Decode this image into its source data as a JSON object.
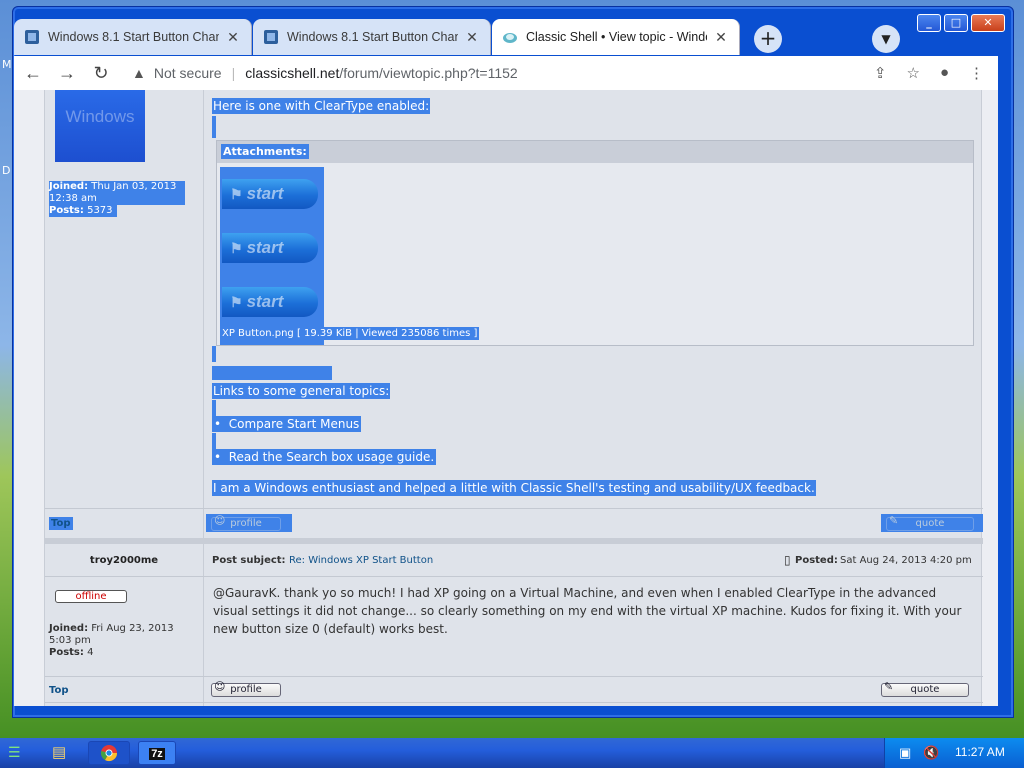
{
  "desktop": {
    "letters": [
      "M",
      "D"
    ]
  },
  "browser": {
    "tabs": [
      {
        "title": "Windows 8.1 Start Button Change",
        "close": "✕"
      },
      {
        "title": "Windows 8.1 Start Button Change",
        "close": "✕"
      },
      {
        "title": "Classic Shell • View topic - Windows",
        "close": "✕"
      }
    ],
    "new_tab": "+",
    "window_buttons": {
      "minimize": "_",
      "maximize": "□",
      "close": "✕"
    },
    "address": {
      "security": "Not secure",
      "host": "classicshell.net",
      "path": "/forum/viewtopic.php?t=1152"
    }
  },
  "post1": {
    "avatar_text": "Windows",
    "joined_label": "Joined:",
    "joined_value": "Thu Jan 03, 2013 12:38 am",
    "posts_label": "Posts:",
    "posts_value": "5373",
    "line_cleartype": "Here is one with ClearType enabled:",
    "attachments_header": "Attachments:",
    "start_label": "start",
    "attachment_caption": "XP Button.png [ 19.39 KiB | Viewed 235086 times ]",
    "links_heading": "Links to some general topics:",
    "link1": "Compare Start Menus",
    "link2": "Read the Search box usage guide.",
    "signature": "I am a Windows enthusiast and helped a little with Classic Shell's testing and usability/UX feedback.",
    "top_link": "Top",
    "profile_btn": "profile",
    "quote_btn": "quote"
  },
  "post2": {
    "author": "troy2000me",
    "subject_label": "Post subject:",
    "subject_value": "Re: Windows XP Start Button",
    "posted_label": "Posted:",
    "posted_value": "Sat Aug 24, 2013 4:20 pm",
    "status": "offline",
    "joined_label": "Joined:",
    "joined_value": "Fri Aug 23, 2013 5:03 pm",
    "posts_label": "Posts:",
    "posts_value": "4",
    "body": "@GauravK. thank yo so much! I had XP going on a Virtual Machine, and even when I enabled ClearType in the advanced visual settings it did not change... so clearly something on my end with the virtual XP machine. Kudos for fixing it. With your new button size 0 (default) works best.",
    "top_link": "Top",
    "profile_btn": "profile",
    "quote_btn": "quote"
  },
  "taskbar": {
    "items": [
      "",
      "",
      "7z"
    ],
    "clock": "11:27 AM"
  }
}
